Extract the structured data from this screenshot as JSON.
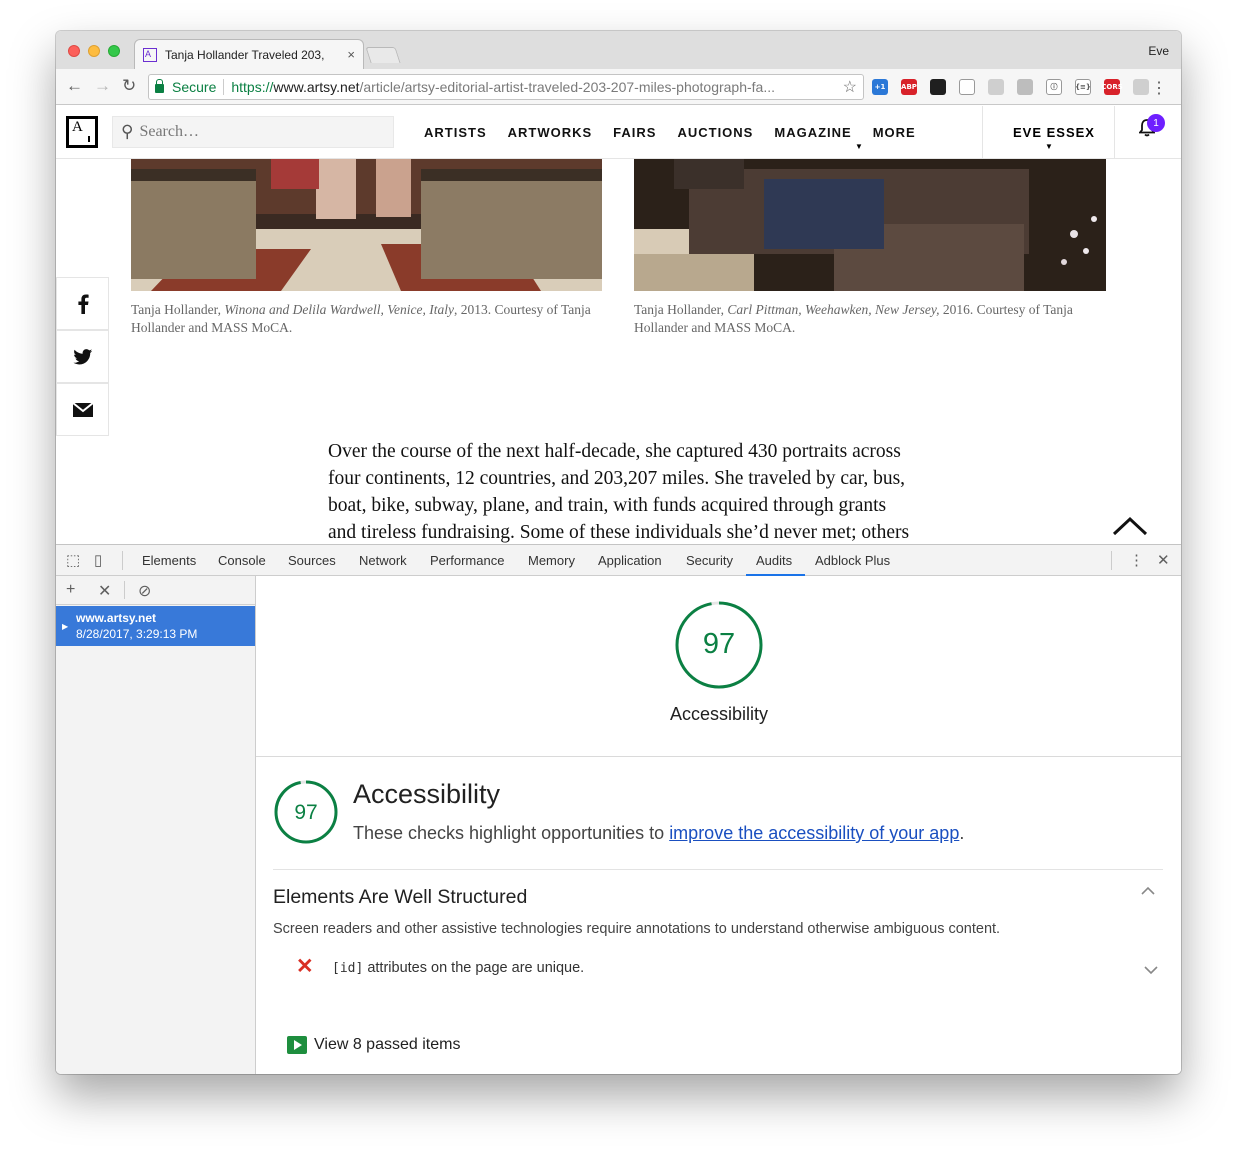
{
  "browser": {
    "tab_title": "Tanja Hollander Traveled 203,",
    "tab_close": "×",
    "profile": "Eve",
    "secure_label": "Secure",
    "url_scheme": "https://",
    "url_host": "www.artsy.net",
    "url_path": "/article/artsy-editorial-artist-traveled-203-207-miles-photograph-fa...",
    "extensions": [
      {
        "name": "plus-one-ext-icon",
        "label": "+1",
        "color": "#2b78d7"
      },
      {
        "name": "adblock-plus-icon",
        "label": "ABP",
        "color": "#d8222a"
      },
      {
        "name": "color-picker-icon",
        "label": "",
        "color": "#1f1f1f"
      },
      {
        "name": "rainbow-ext-icon",
        "label": "",
        "color": "#ffffff"
      },
      {
        "name": "dropbox-icon",
        "label": "",
        "color": "#cfcfcf"
      },
      {
        "name": "grid-ext-icon",
        "label": "",
        "color": "#bdbdbd"
      },
      {
        "name": "info-ext-icon",
        "label": "ⓘ",
        "color": "#ffffff"
      },
      {
        "name": "json-ext-icon",
        "label": "{≡}",
        "color": "#ffffff"
      },
      {
        "name": "cors-ext-icon",
        "label": "CORS",
        "color": "#d8222a"
      },
      {
        "name": "settings-ext-icon",
        "label": "",
        "color": "#cfcfcf"
      }
    ]
  },
  "artsy": {
    "search_placeholder": "Search…",
    "nav": [
      "ARTISTS",
      "ARTWORKS",
      "FAIRS",
      "AUCTIONS",
      "MAGAZINE",
      "MORE"
    ],
    "user": "EVE ESSEX",
    "notifications": "1",
    "captions": [
      {
        "artist": "Tanja Hollander, ",
        "title": "Winona and Delila Wardwell, Venice, Italy",
        "rest": ", 2013. Courtesy of Tanja Hollander and MASS MoCA."
      },
      {
        "artist": "Tanja Hollander, ",
        "title": "Carl Pittman, Weehawken, New Jersey,",
        "rest": " 2016. Courtesy of Tanja Hollander and MASS MoCA."
      }
    ],
    "body": "Over the course of the next half-decade, she captured 430 portraits across four continents, 12 countries, and 203,207 miles. She traveled by car, bus, boat, bike, subway, plane, and train, with funds acquired through grants and tireless fundraising. Some of these individuals she’d never met; others she hadn’t seen in decades, like her sister’s sixth-grade best friend, who now"
  },
  "devtools": {
    "tabs": [
      "Elements",
      "Console",
      "Sources",
      "Network",
      "Performance",
      "Memory",
      "Application",
      "Security",
      "Audits",
      "Adblock Plus"
    ],
    "active_tab": "Audits",
    "report": {
      "host": "www.artsy.net",
      "time": "8/28/2017, 3:29:13 PM"
    },
    "score": 97,
    "score_label": "Accessibility",
    "category": {
      "title": "Accessibility",
      "desc_prefix": "These checks highlight opportunities to ",
      "desc_link": "improve the accessibility of your app",
      "desc_suffix": "."
    },
    "group": {
      "title": "Elements Are Well Structured",
      "desc": "Screen readers and other assistive technologies require annotations to understand otherwise ambiguous content."
    },
    "audit": {
      "code": "[id]",
      "text": " attributes on the page are unique."
    },
    "passed_label": "View 8 passed items",
    "colors": {
      "pass": "#0b8043",
      "fail": "#d93025",
      "accent": "#1a73e8"
    }
  }
}
